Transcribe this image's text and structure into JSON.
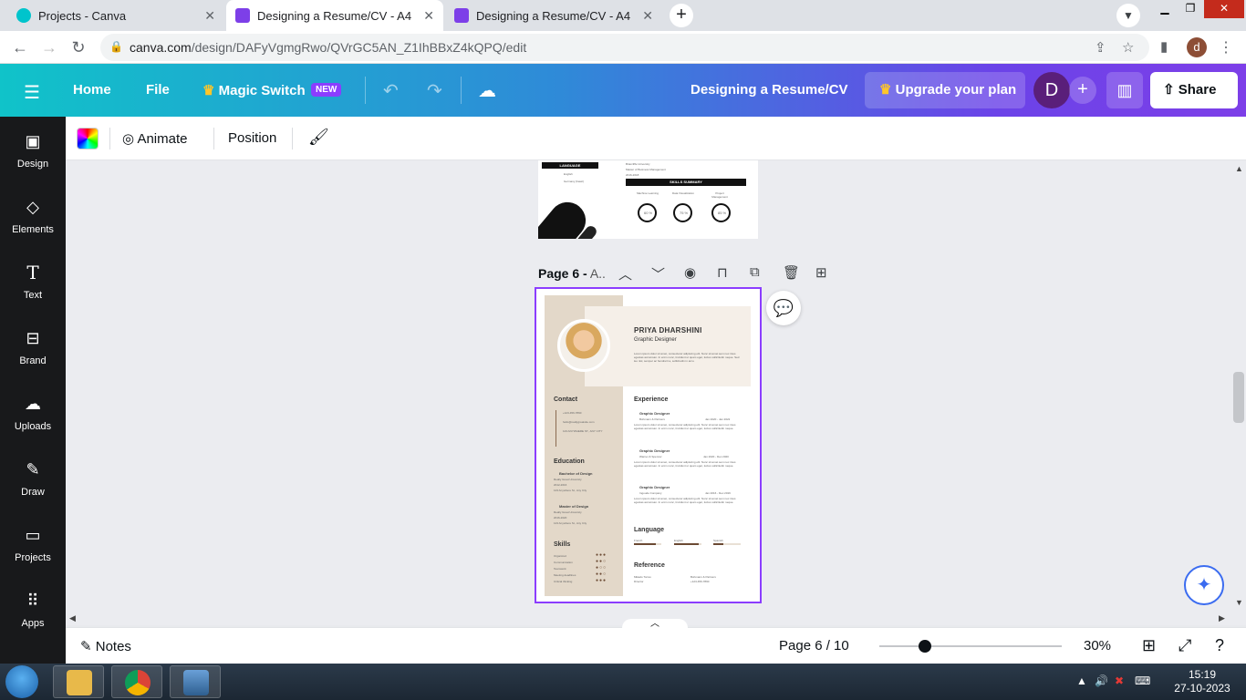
{
  "browser": {
    "tabs": [
      {
        "title": "Projects - Canva",
        "active": false
      },
      {
        "title": "Designing a Resume/CV - A4",
        "active": true
      },
      {
        "title": "Designing a Resume/CV - A4",
        "active": false
      }
    ],
    "url_host": "canva.com",
    "url_path": "/design/DAFyVgmgRwo/QVrGC5AN_Z1IhBBxZ4kQPQ/edit",
    "profile_initial": "d"
  },
  "header": {
    "home": "Home",
    "file": "File",
    "magic_switch": "Magic Switch",
    "new_badge": "NEW",
    "doc_title": "Designing a Resume/CV",
    "upgrade": "Upgrade your plan",
    "avatar_initial": "D",
    "share": "Share",
    "gradient_start": "#10c3c9",
    "gradient_end": "#7d3fe8"
  },
  "sidebar": {
    "items": [
      {
        "label": "Design",
        "icon": "layout-icon"
      },
      {
        "label": "Elements",
        "icon": "shapes-icon"
      },
      {
        "label": "Text",
        "icon": "text-icon"
      },
      {
        "label": "Brand",
        "icon": "brand-icon"
      },
      {
        "label": "Uploads",
        "icon": "cloud-upload-icon"
      },
      {
        "label": "Draw",
        "icon": "draw-icon"
      },
      {
        "label": "Projects",
        "icon": "folder-icon"
      },
      {
        "label": "Apps",
        "icon": "apps-grid-icon"
      }
    ]
  },
  "context_toolbar": {
    "animate": "Animate",
    "position": "Position"
  },
  "canvas": {
    "prev_page": {
      "language_heading": "LANGUAGE",
      "lang1": "English",
      "lang2": "Germany (basic)",
      "uni": "Briarcliffe University",
      "degree": "Master of Business Management",
      "years": "2016-2018",
      "skills_summary": "SKILLS SUMMARY",
      "skill1": "Machine Learning",
      "skill2": "Data Visualization",
      "skill3": "Project Management",
      "skill1_value": "60 %",
      "skill2_value": "75 %",
      "skill3_value": "85 %"
    },
    "page_label": "Page 6 -",
    "page_label_rest": " A..",
    "resume": {
      "name": "PRIYA DHARSHINI",
      "role": "Graphic Designer",
      "intro": "Lorem ipsum dolor sit amet, consectetur adipiscing elit. Nunc sit amet sem nec risus egestas accumsan. In enim nunc, tincidunt ut quam eget, luctus sollicitudin neque. Sed leo nisl, semper ac hendrerit a, sollicitudin in arcu.",
      "contact_heading": "Contact",
      "phone": "+123-456-7890",
      "email": "hello@reallygreatsite.com",
      "address": "123 ANYWHERE ST., ANY CITY",
      "education_heading": "Education",
      "edu1_title": "Bachelor of Design",
      "edu1_school": "Really Great University",
      "edu1_years": "2012-2016",
      "edu1_addr": "123 Anywhere St., Any City",
      "edu2_title": "Master of Design",
      "edu2_school": "Really Great University",
      "edu2_years": "2016-2020",
      "edu2_addr": "123 Anywhere St., Any City",
      "skills_heading": "Skills",
      "skills": [
        {
          "name": "Organized",
          "dots": "●●●"
        },
        {
          "name": "Communication",
          "dots": "●●○"
        },
        {
          "name": "Teamwork",
          "dots": "●○○"
        },
        {
          "name": "Meeting deadlines",
          "dots": "●●○"
        },
        {
          "name": "Critical thinking",
          "dots": "●●●"
        }
      ],
      "experience_heading": "Experience",
      "jobs": [
        {
          "title": "Graphic Designer",
          "company": "Bohmann & Partners",
          "dates": "Jan 2020 - Jan 2022",
          "desc": "Lorem ipsum dolor sit amet, consectetur adipiscing elit. Nunc sit amet sem nec risus egestas accumsan. In enim nunc, tincidunt ut quam eget, luctus sollicitudin neque."
        },
        {
          "title": "Graphic Designer",
          "company": "Warner & Spencer",
          "dates": "Jan 2020 - Dec 2020",
          "desc": "Lorem ipsum dolor sit amet, consectetur adipiscing elit. Nunc sit amet sem nec risus egestas accumsan. In enim nunc, tincidunt ut quam eget, luctus sollicitudin neque."
        },
        {
          "title": "Graphic Designer",
          "company": "Ingoude Company",
          "dates": "Jan 2016 - Dec 2019",
          "desc": "Lorem ipsum dolor sit amet, consectetur adipiscing elit. Nunc sit amet sem nec risus egestas accumsan. In enim nunc, tincidunt ut quam eget, luctus sollicitudin neque."
        }
      ],
      "language_heading": "Language",
      "languages": [
        {
          "name": "French",
          "level": 0.8
        },
        {
          "name": "English",
          "level": 0.9
        },
        {
          "name": "Spanish",
          "level": 0.35
        }
      ],
      "reference_heading": "Reference",
      "ref_name": "Mikado Torres",
      "ref_title": "Director",
      "ref_company": "Bohmann & Partners",
      "ref_phone": "+123-456-7890"
    }
  },
  "bottom": {
    "notes": "Notes",
    "page_info": "Page 6 / 10",
    "zoom": "30%",
    "zoom_fraction": 0.25
  },
  "taskbar": {
    "time": "15:19",
    "date": "27-10-2023"
  }
}
